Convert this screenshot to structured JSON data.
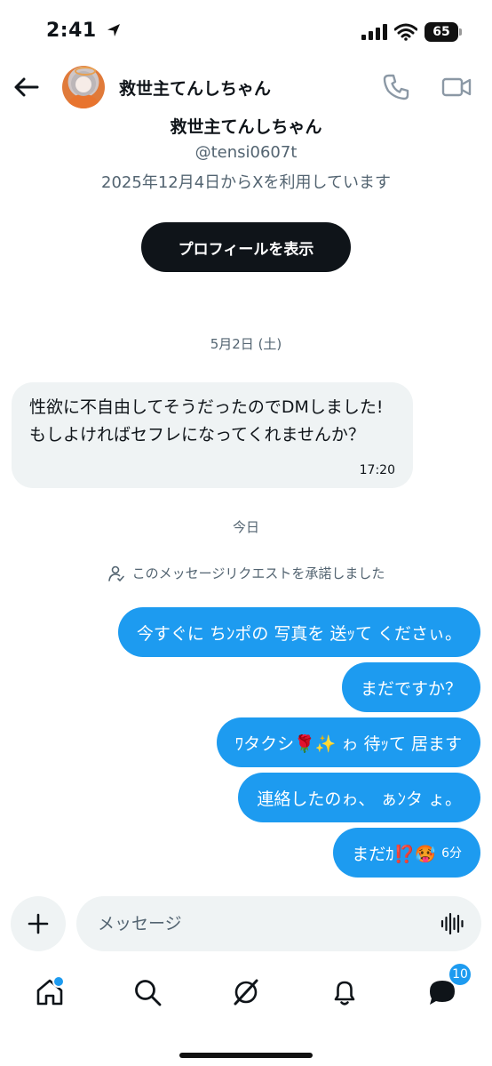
{
  "status_bar": {
    "time": "2:41",
    "battery": "65"
  },
  "header": {
    "name": "救世主てんしちゃん"
  },
  "profile": {
    "name": "救世主てんしちゃん",
    "handle": "@tensi0607t",
    "since": "2025年12月4日からXを利用しています",
    "button_label": "プロフィールを表示"
  },
  "conversation": {
    "date_1": "5月2日 (土)",
    "incoming_text": "性欲に不自由してそうだったのでDMしました!もしよければセフレになってくれませんか？",
    "incoming_time": "17:20",
    "date_2": "今日",
    "request_note": "このメッセージリクエストを承諾しました",
    "outgoing": [
      "今すぐに ちﾝポの 写真を 送ｯて くださぃ。",
      "まだですか？",
      "ﾜタクシ🌹✨ ゎ 待ｯて 居ます",
      "連絡したのゎ、 ぁﾝタ ょ。",
      "まだｶ⁉️🥵"
    ],
    "last_time": "6分"
  },
  "composer": {
    "placeholder": "メッセージ"
  },
  "nav": {
    "messages_badge": "10"
  }
}
